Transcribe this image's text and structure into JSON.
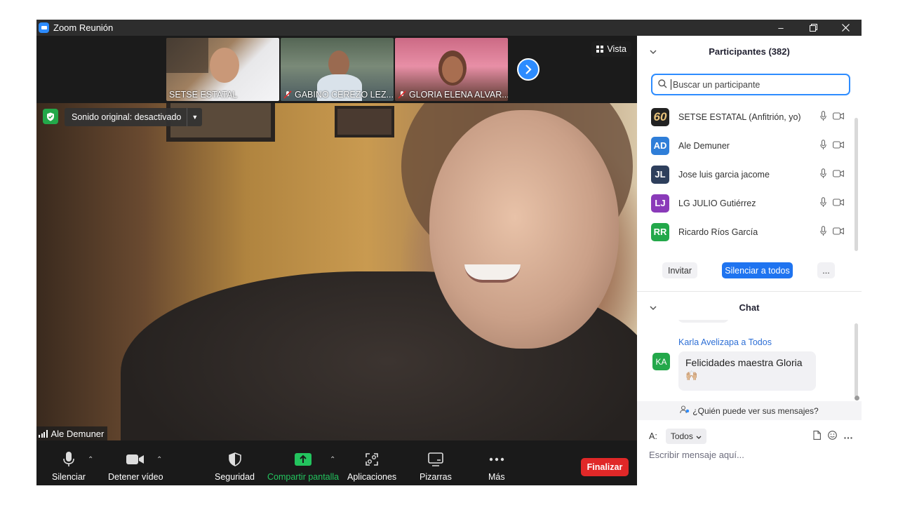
{
  "window": {
    "title": "Zoom Reunión"
  },
  "video": {
    "view_label": "Vista",
    "thumbnails": [
      {
        "name": "SETSE ESTATAL",
        "muted": false
      },
      {
        "name": "GABINO CEREZO LEZ...",
        "muted": true
      },
      {
        "name": "GLORIA ELENA ALVAR...",
        "muted": true
      }
    ],
    "original_sound": "Sonido original: desactivado",
    "speaker_name": "Ale Demuner"
  },
  "toolbar": {
    "mute": "Silenciar",
    "stop_video": "Detener vídeo",
    "security": "Seguridad",
    "share_screen": "Compartir pantalla",
    "apps": "Aplicaciones",
    "whiteboards": "Pizarras",
    "more": "Más",
    "end": "Finalizar"
  },
  "participants": {
    "header": "Participantes (382)",
    "search_placeholder": "Buscar un participante",
    "list": [
      {
        "initials": "60",
        "name": "SETSE ESTATAL (Anfitrión, yo)",
        "color": "#222222"
      },
      {
        "initials": "AD",
        "name": "Ale Demuner",
        "color": "#2f7ed8"
      },
      {
        "initials": "JL",
        "name": "Jose luis garcia jacome",
        "color": "#2e3f5c"
      },
      {
        "initials": "LJ",
        "name": "LG JULIO Gutiérrez",
        "color": "#8a3ab9"
      },
      {
        "initials": "RR",
        "name": "Ricardo Ríos García",
        "color": "#23a84a"
      }
    ],
    "invite": "Invitar",
    "mute_all": "Silenciar a todos",
    "more": "..."
  },
  "chat": {
    "header": "Chat",
    "messages": [
      {
        "sender": "Karla Avelizapa a Todos",
        "initials": "KA",
        "text": "Felicidades maestra Gloria",
        "emoji": "🙌🏼"
      }
    ],
    "who_can_see": "¿Quién puede ver sus mensajes?",
    "to_label": "A:",
    "to_value": "Todos",
    "input_placeholder": "Escribir mensaje aquí..."
  },
  "colors": {
    "accent": "#2d8cff",
    "end": "#e02828",
    "share": "#23c45e",
    "toolbar_bg": "#1a1a1a"
  }
}
